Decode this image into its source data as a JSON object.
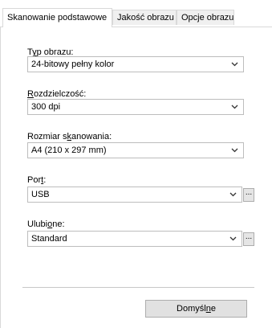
{
  "tabs": [
    {
      "label": "Skanowanie podstawowe",
      "active": true
    },
    {
      "label": "Jakość obrazu",
      "active": false
    },
    {
      "label": "Opcje obrazu",
      "active": false
    }
  ],
  "fields": {
    "image_type": {
      "label_pre": "T",
      "label_u": "y",
      "label_post": "p obrazu:",
      "value": "24-bitowy pełny kolor"
    },
    "resolution": {
      "label_pre": "",
      "label_u": "R",
      "label_post": "ozdzielczość:",
      "value": "300 dpi"
    },
    "scan_size": {
      "label_pre": "Rozmiar s",
      "label_u": "k",
      "label_post": "anowania:",
      "value": "A4 (210 x 297 mm)"
    },
    "port": {
      "label_pre": "Por",
      "label_u": "t",
      "label_post": ":",
      "value": "USB"
    },
    "favorites": {
      "label_pre": "Ulubi",
      "label_u": "o",
      "label_post": "ne:",
      "value": "Standard"
    }
  },
  "ellipsis_label": "...",
  "defaults_button": {
    "pre": "Domyśl",
    "u": "n",
    "post": "e"
  }
}
